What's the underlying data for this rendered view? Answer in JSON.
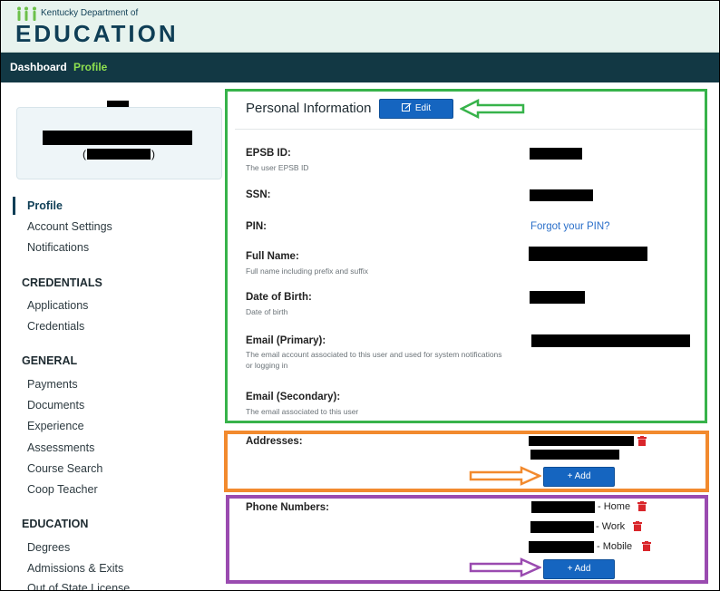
{
  "header": {
    "org_small": "Kentucky Department of",
    "org_big": "EDUCATION"
  },
  "topnav": {
    "items": [
      {
        "label": "Dashboard"
      },
      {
        "label": "Profile"
      }
    ]
  },
  "usercard": {
    "paren_open": "(",
    "paren_close": ")"
  },
  "sidebar": {
    "profile": "Profile",
    "account_settings": "Account Settings",
    "notifications": "Notifications",
    "credentials_head": "CREDENTIALS",
    "applications": "Applications",
    "credentials": "Credentials",
    "general_head": "GENERAL",
    "payments": "Payments",
    "documents": "Documents",
    "experience": "Experience",
    "assessments": "Assessments",
    "course_search": "Course Search",
    "coop_teacher": "Coop Teacher",
    "education_head": "EDUCATION",
    "degrees": "Degrees",
    "admissions": "Admissions & Exits",
    "out_of_state": "Out of State License"
  },
  "personal": {
    "title": "Personal Information",
    "edit_label": "Edit",
    "fields": {
      "epsb_label": "EPSB ID:",
      "epsb_help": "The user EPSB ID",
      "ssn_label": "SSN:",
      "pin_label": "PIN:",
      "pin_link": "Forgot your PIN?",
      "fullname_label": "Full Name:",
      "fullname_help": "Full name including prefix and suffix",
      "dob_label": "Date of Birth:",
      "dob_help": "Date of birth",
      "email1_label": "Email (Primary):",
      "email1_help": "The email account associated to this user and used for system notifications or logging in",
      "email2_label": "Email (Secondary):",
      "email2_help": "The email associated to this user"
    }
  },
  "addresses": {
    "label": "Addresses:",
    "add_label": "+ Add"
  },
  "phones": {
    "label": "Phone Numbers:",
    "types": [
      "- Home",
      "- Work",
      "- Mobile"
    ],
    "add_label": "+ Add"
  },
  "colors": {
    "brand_dark": "#123844",
    "nav_active": "#8ee04f",
    "button_blue": "#1565c0",
    "annotation_green": "#37b34a",
    "annotation_orange": "#f28a2e",
    "annotation_purple": "#9a4bb0",
    "delete_red": "#d9262b"
  }
}
